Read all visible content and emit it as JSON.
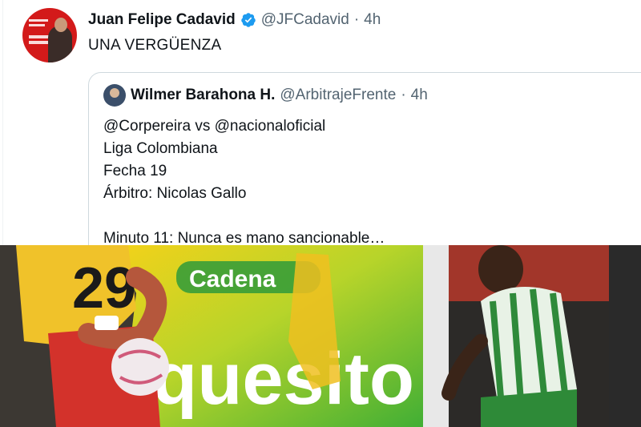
{
  "tweet": {
    "author_name": "Juan Felipe Cadavid",
    "author_handle": "@JFCadavid",
    "separator": "·",
    "time": "4h",
    "text": "UNA VERGÜENZA",
    "avatar_icon": "profile-photo-icon",
    "verified_icon": "verified-badge-icon",
    "verified_color": "#1d9bf0"
  },
  "quote": {
    "author_name": "Wilmer Barahona H.",
    "author_handle": "@ArbitrajeFrente",
    "separator": "·",
    "time": "4h",
    "lines": [
      "@Corpereira vs @nacionaloficial",
      "Liga Colombiana",
      "Fecha 19",
      "Árbitro: Nicolas Gallo",
      "",
      "Minuto 11: Nunca es mano sancionable…"
    ]
  },
  "media": {
    "jersey_number": "29",
    "ad_word": "quesito",
    "ad_brand": "Cadena"
  },
  "colors": {
    "text_primary": "#0f1419",
    "text_secondary": "#536471",
    "border": "#cfd9de",
    "avatar_bg": "#d31a1a"
  }
}
